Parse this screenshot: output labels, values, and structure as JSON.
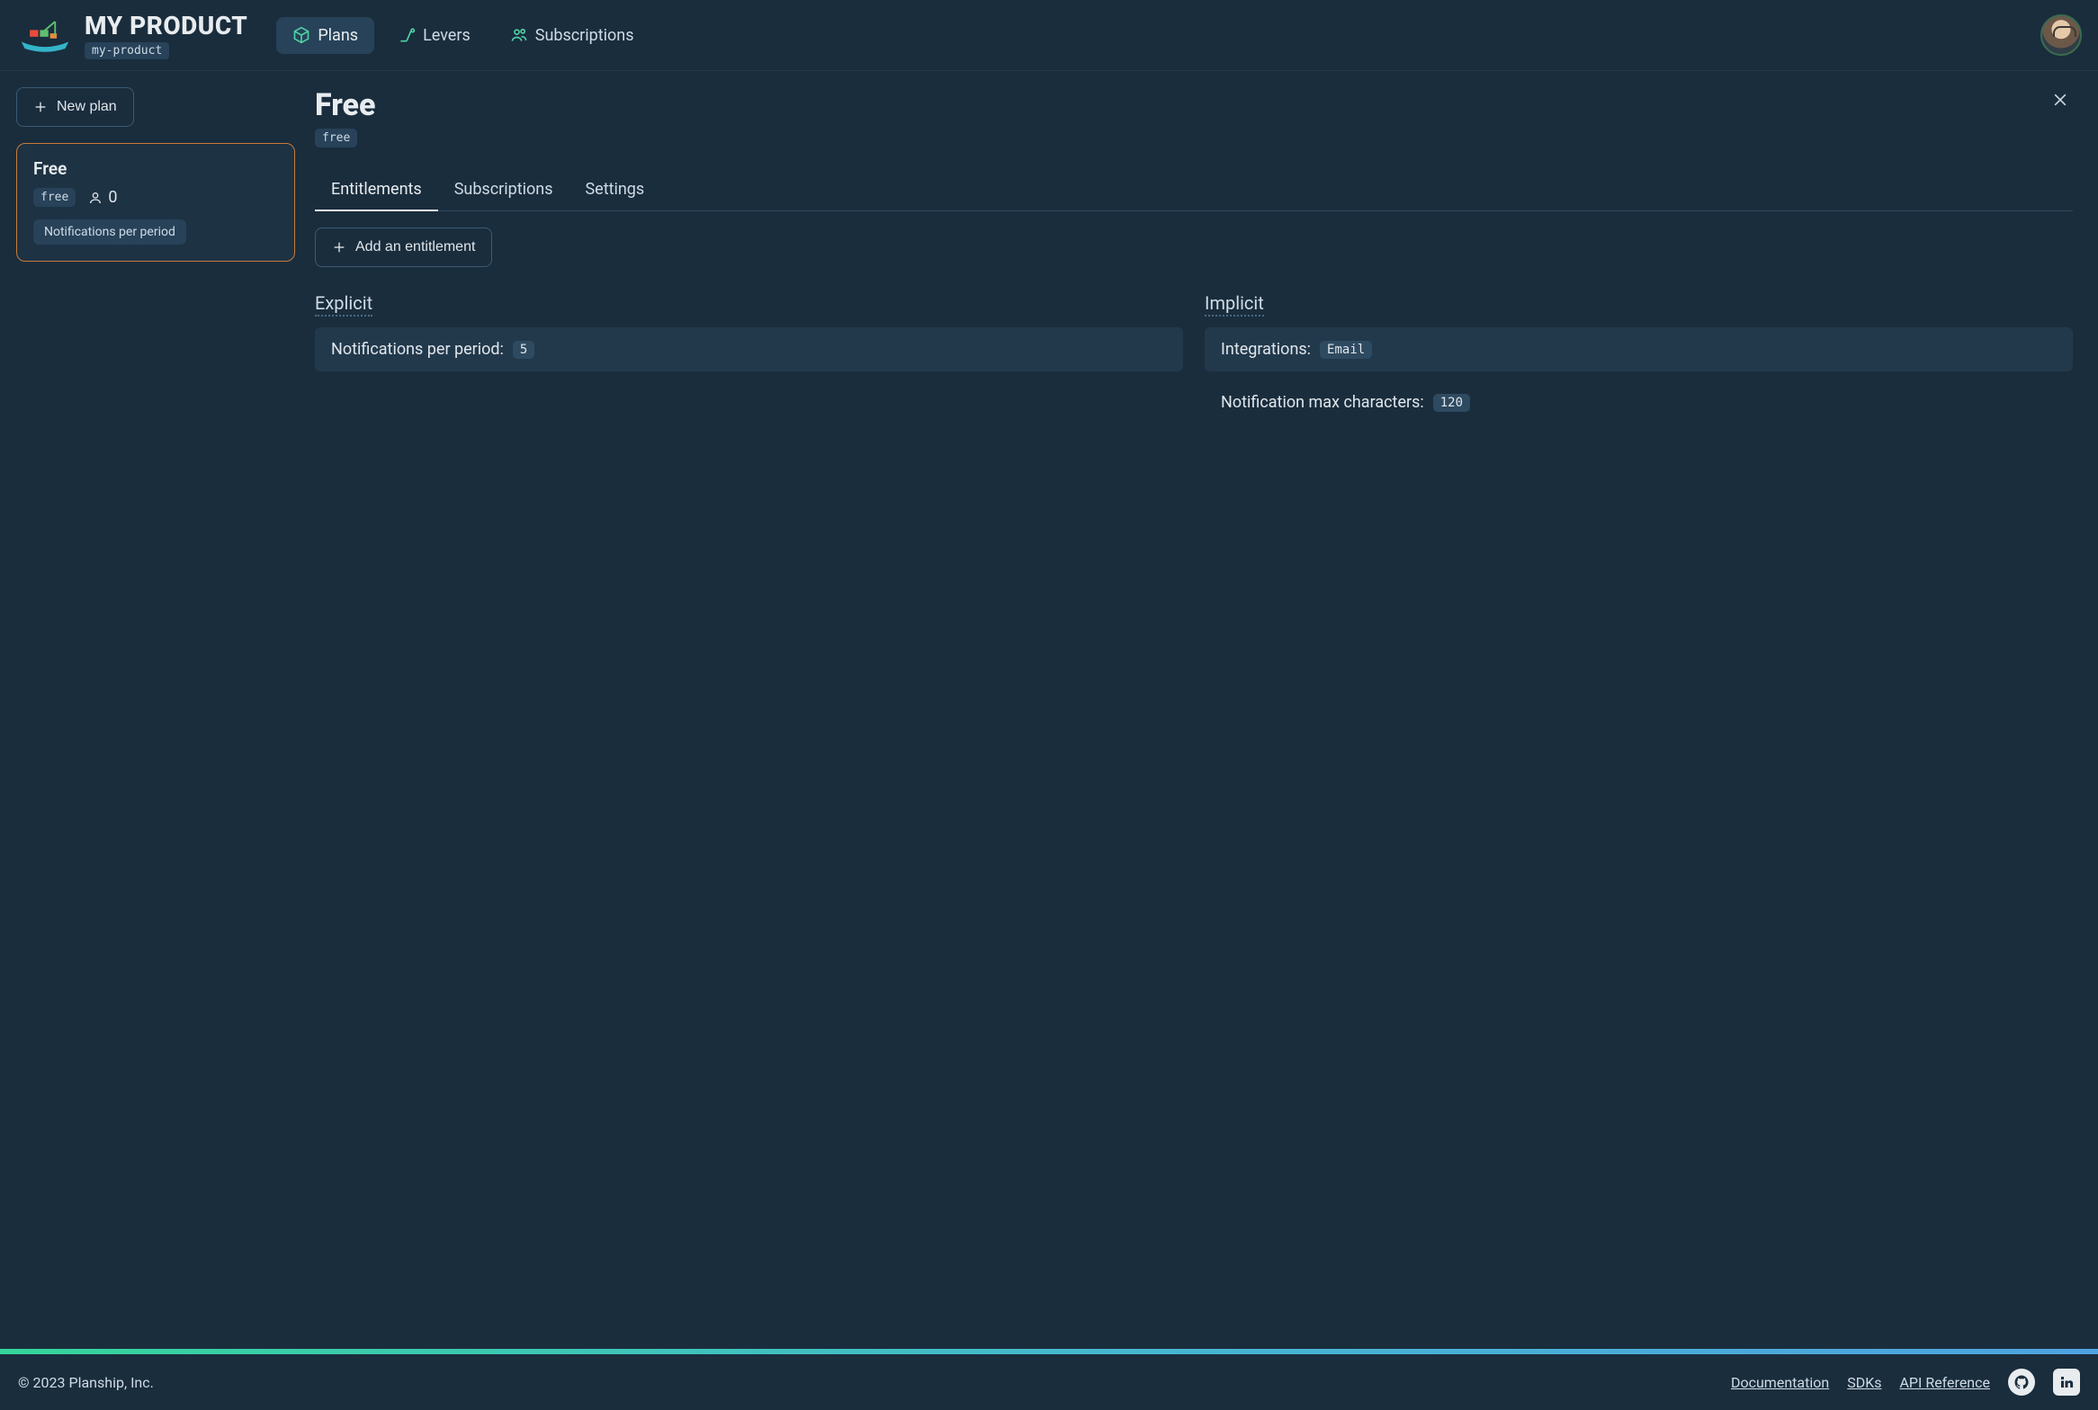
{
  "header": {
    "product_name": "MY PRODUCT",
    "product_slug": "my-product",
    "nav": {
      "plans": "Plans",
      "levers": "Levers",
      "subscriptions": "Subscriptions"
    }
  },
  "sidebar": {
    "new_plan": "New plan",
    "plan_card": {
      "title": "Free",
      "slug": "free",
      "user_count": "0",
      "entitlement_chip": "Notifications per period"
    }
  },
  "main": {
    "title": "Free",
    "slug": "free",
    "tabs": {
      "entitlements": "Entitlements",
      "subscriptions": "Subscriptions",
      "settings": "Settings"
    },
    "add_entitlement": "Add an entitlement",
    "explicit_label": "Explicit",
    "implicit_label": "Implicit",
    "explicit": [
      {
        "label": "Notifications per period:",
        "value": "5"
      }
    ],
    "implicit": [
      {
        "label": "Integrations:",
        "value": "Email",
        "bg": true
      },
      {
        "label": "Notification max characters:",
        "value": "120",
        "bg": false
      }
    ]
  },
  "footer": {
    "copyright": "© 2023 Planship, Inc.",
    "links": {
      "docs": "Documentation",
      "sdks": "SDKs",
      "api": "API Reference"
    }
  }
}
